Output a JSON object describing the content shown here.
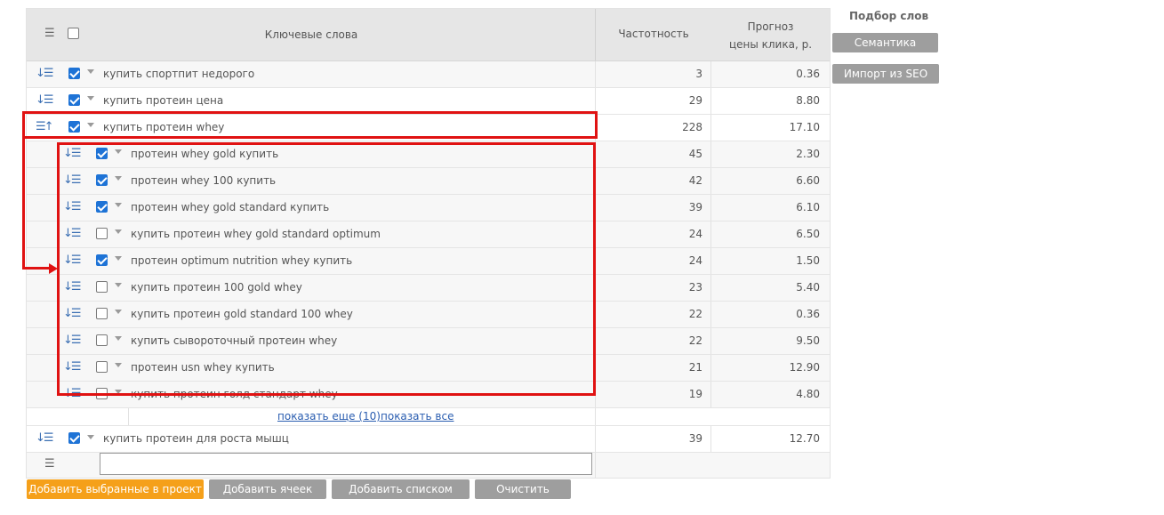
{
  "header": {
    "keywords": "Ключевые слова",
    "frequency": "Частотность",
    "price_line1": "Прогноз",
    "price_line2": "цены клика, р."
  },
  "rows": [
    {
      "keyword": "купить спортпит недорого",
      "frequency": "3",
      "price": "0.36",
      "checked": true,
      "level": 0
    },
    {
      "keyword": "купить протеин цена",
      "frequency": "29",
      "price": "8.80",
      "checked": true,
      "level": 0
    },
    {
      "keyword": "купить протеин whey",
      "frequency": "228",
      "price": "17.10",
      "checked": true,
      "level": 0,
      "expanded": true
    },
    {
      "keyword": "протеин whey gold купить",
      "frequency": "45",
      "price": "2.30",
      "checked": true,
      "level": 1
    },
    {
      "keyword": "протеин whey 100 купить",
      "frequency": "42",
      "price": "6.60",
      "checked": true,
      "level": 1
    },
    {
      "keyword": "протеин whey gold standard купить",
      "frequency": "39",
      "price": "6.10",
      "checked": true,
      "level": 1
    },
    {
      "keyword": "купить протеин whey gold standard optimum",
      "frequency": "24",
      "price": "6.50",
      "checked": false,
      "level": 1
    },
    {
      "keyword": "протеин optimum nutrition whey купить",
      "frequency": "24",
      "price": "1.50",
      "checked": true,
      "level": 1
    },
    {
      "keyword": "купить протеин 100 gold whey",
      "frequency": "23",
      "price": "5.40",
      "checked": false,
      "level": 1
    },
    {
      "keyword": "купить протеин gold standard 100 whey",
      "frequency": "22",
      "price": "0.36",
      "checked": false,
      "level": 1
    },
    {
      "keyword": "купить сывороточный протеин whey",
      "frequency": "22",
      "price": "9.50",
      "checked": false,
      "level": 1
    },
    {
      "keyword": "протеин usn whey купить",
      "frequency": "21",
      "price": "12.90",
      "checked": false,
      "level": 1
    },
    {
      "keyword": "купить протеин голд стандарт whey",
      "frequency": "19",
      "price": "4.80",
      "checked": false,
      "level": 1
    }
  ],
  "more": {
    "show_more": "показать еще (10)",
    "show_all": "показать все"
  },
  "last_row": {
    "keyword": "купить протеин для роста мышц",
    "frequency": "39",
    "price": "12.70",
    "checked": true
  },
  "input": {
    "value": ""
  },
  "side": {
    "title": "Подбор слов",
    "semantics": "Семантика",
    "import_seo": "Импорт из SEO"
  },
  "buttons": {
    "add_selected": "Добавить выбранные в проект",
    "add_cells": "Добавить ячеек",
    "add_list": "Добавить списком",
    "clear": "Очистить"
  },
  "icons": {
    "sort_down": "↓☰",
    "sort_up": "☰↑",
    "tree": "☰"
  },
  "colors": {
    "accent_orange": "#f5a01a",
    "button_gray": "#9e9e9e",
    "checkbox_blue": "#1e73d6",
    "link_blue": "#2a5db0",
    "highlight_red": "#e01212"
  }
}
